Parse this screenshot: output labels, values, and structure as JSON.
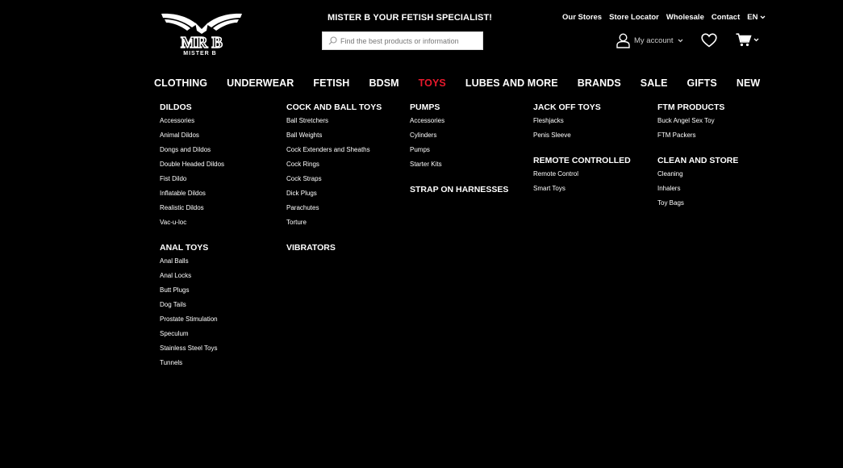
{
  "brand": {
    "logo_text": "MR B",
    "logo_subtitle": "MISTER B",
    "tagline": "MISTER B YOUR FETISH SPECIALIST!"
  },
  "search": {
    "placeholder": "Find the best products or information",
    "value": ""
  },
  "top_links": {
    "stores": "Our Stores",
    "store_locator": "Store Locator",
    "wholesale": "Wholesale",
    "contact": "Contact",
    "language": "EN"
  },
  "account": {
    "label": "My account"
  },
  "icons": {
    "search": "search-icon",
    "account": "user-icon",
    "wishlist": "heart-icon",
    "cart": "cart-icon",
    "dropdown": "chevron-down-icon"
  },
  "colors": {
    "background": "#000000",
    "text": "#ffffff",
    "accent": "#e8192c"
  },
  "nav": {
    "items": [
      "CLOTHING",
      "UNDERWEAR",
      "FETISH",
      "BDSM",
      "TOYS",
      "LUBES AND MORE",
      "BRANDS",
      "SALE",
      "GIFTS",
      "NEW"
    ],
    "active": "TOYS"
  },
  "menu": {
    "dildos": {
      "title": "DILDOS",
      "items": [
        "Accessories",
        "Animal Dildos",
        "Dongs and Dildos",
        "Double Headed Dildos",
        "Fist Dildo",
        "Inflatable Dildos",
        "Realistic Dildos",
        "Vac-u-loc"
      ]
    },
    "anal_toys": {
      "title": "ANAL TOYS",
      "items": [
        "Anal Balls",
        "Anal Locks",
        "Butt Plugs",
        "Dog Tails",
        "Prostate Stimulation",
        "Speculum",
        "Stainless Steel Toys",
        "Tunnels"
      ]
    },
    "cock_ball_toys": {
      "title": "COCK AND BALL TOYS",
      "items": [
        "Ball Stretchers",
        "Ball Weights",
        "Cock Extenders and Sheaths",
        "Cock Rings",
        "Cock Straps",
        "Dick Plugs",
        "Parachutes",
        "Torture"
      ]
    },
    "vibrators": {
      "title": "VIBRATORS"
    },
    "pumps": {
      "title": "PUMPS",
      "items": [
        "Accessories",
        "Cylinders",
        "Pumps",
        "Starter Kits"
      ]
    },
    "strap_on": {
      "title": "STRAP ON HARNESSES"
    },
    "jack_off_toys": {
      "title": "JACK OFF TOYS",
      "items": [
        "Fleshjacks",
        "Penis Sleeve"
      ]
    },
    "remote_controlled": {
      "title": "REMOTE CONTROLLED",
      "items": [
        "Remote Control",
        "Smart Toys"
      ]
    },
    "ftm_products": {
      "title": "FTM PRODUCTS",
      "items": [
        "Buck Angel Sex Toy",
        "FTM Packers"
      ]
    },
    "clean_store": {
      "title": "CLEAN AND STORE",
      "items": [
        "Cleaning",
        "Inhalers",
        "Toy Bags"
      ]
    }
  }
}
